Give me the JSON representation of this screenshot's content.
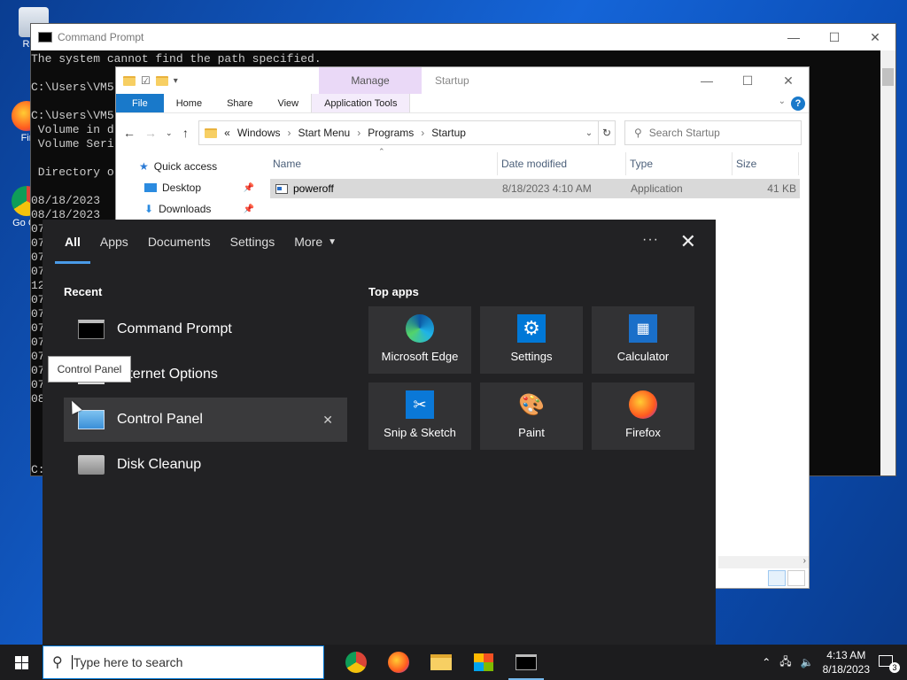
{
  "desktop": {
    "icons": [
      {
        "label": "Recy"
      },
      {
        "label": "Fir"
      },
      {
        "label": "Go Ch"
      }
    ]
  },
  "cmd": {
    "title": "Command Prompt",
    "lines": [
      "The system cannot find the path specified.",
      "",
      "C:\\Users\\VM5",
      "",
      "C:\\Users\\VM5",
      " Volume in d",
      " Volume Seri",
      "",
      " Directory o",
      "",
      "08/18/2023",
      "08/18/2023",
      "07",
      "07",
      "07",
      "07",
      "12",
      "07",
      "07",
      "07",
      "07",
      "07",
      "07",
      "07",
      "08",
      "",
      "",
      "",
      "",
      "C:"
    ]
  },
  "explorer": {
    "manage_label": "Manage",
    "title": "Startup",
    "ribbon_tabs": [
      "File",
      "Home",
      "Share",
      "View",
      "Application Tools"
    ],
    "help": "?",
    "address": [
      "«",
      "Windows",
      "›",
      "Start Menu",
      "›",
      "Programs",
      "›",
      "Startup"
    ],
    "search_placeholder": "Search Startup",
    "nav_items": [
      "Quick access",
      "Desktop",
      "Downloads"
    ],
    "columns": [
      "Name",
      "Date modified",
      "Type",
      "Size"
    ],
    "files": [
      {
        "name": "poweroff",
        "date": "8/18/2023 4:10 AM",
        "type": "Application",
        "size": "41 KB"
      }
    ]
  },
  "start": {
    "tabs": [
      "All",
      "Apps",
      "Documents",
      "Settings",
      "More"
    ],
    "ellipsis": "···",
    "close": "✕",
    "recent_title": "Recent",
    "recent": [
      "Command Prompt",
      "Internet Options",
      "Control Panel",
      "Disk Cleanup"
    ],
    "top_apps_title": "Top apps",
    "top_apps": [
      "Microsoft Edge",
      "Settings",
      "Calculator",
      "Snip & Sketch",
      "Paint",
      "Firefox"
    ],
    "tooltip": "Control Panel",
    "remove": "✕"
  },
  "taskbar": {
    "search_placeholder": "Type here to search",
    "time": "4:13 AM",
    "date": "8/18/2023",
    "notifications": "3"
  }
}
